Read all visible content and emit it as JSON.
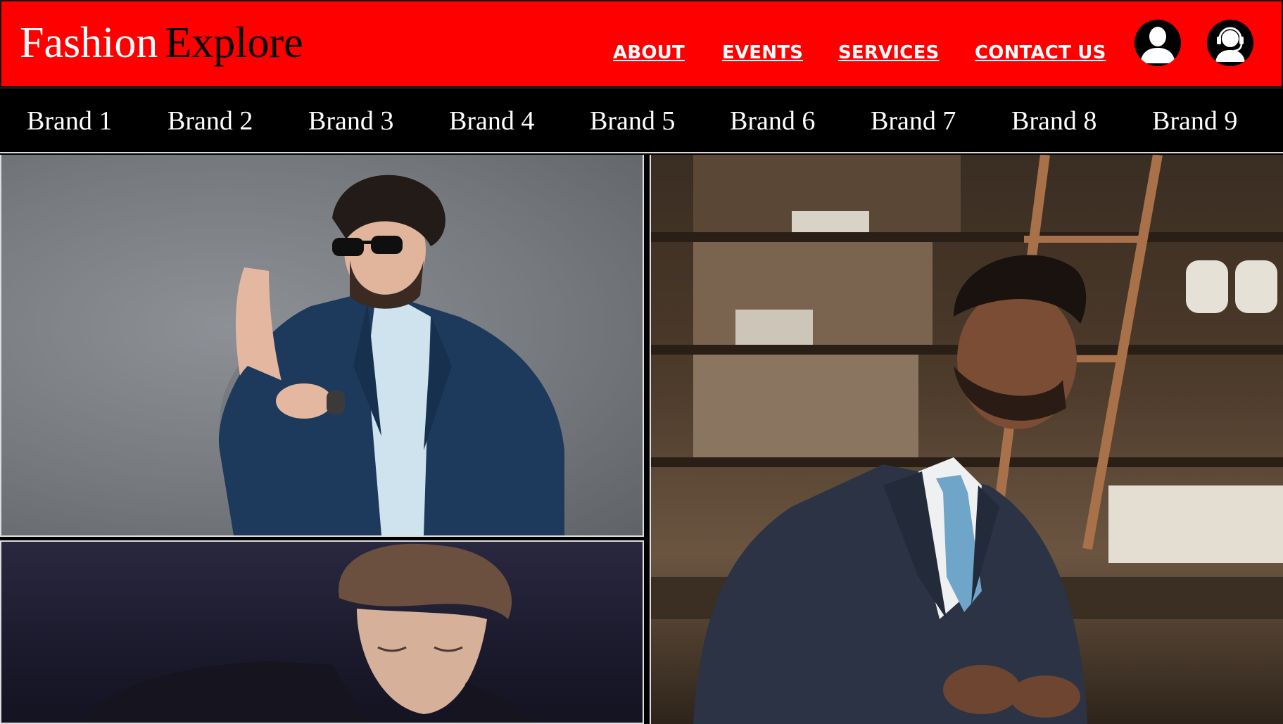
{
  "header": {
    "logo_part1": "Fashion",
    "logo_part2": "Explore",
    "nav": [
      {
        "label": "ABOUT"
      },
      {
        "label": "EVENTS"
      },
      {
        "label": "SERVICES"
      },
      {
        "label": "CONTACT US"
      }
    ],
    "icons": [
      "user-icon",
      "customer-support-icon"
    ]
  },
  "brands": [
    {
      "label": "Brand 1"
    },
    {
      "label": "Brand 2"
    },
    {
      "label": "Brand 3"
    },
    {
      "label": "Brand 4"
    },
    {
      "label": "Brand 5"
    },
    {
      "label": "Brand 6"
    },
    {
      "label": "Brand 7"
    },
    {
      "label": "Brand 8"
    },
    {
      "label": "Brand 9"
    }
  ],
  "colors": {
    "header_bg": "#ff0000",
    "brandbar_bg": "#000000",
    "text_light": "#ffffff"
  }
}
